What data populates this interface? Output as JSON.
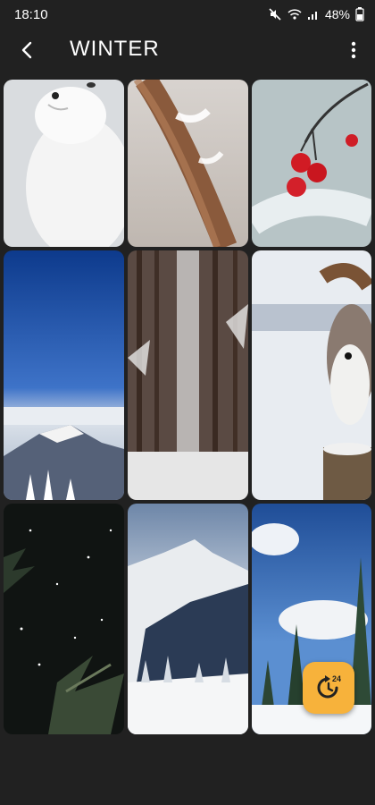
{
  "status_bar": {
    "time": "18:10",
    "battery": "48%",
    "icons": [
      "mute-icon",
      "wifi-icon",
      "signal-icon",
      "battery-icon"
    ]
  },
  "app_bar": {
    "title": "WINTER",
    "back_icon": "back-arrow-icon",
    "menu_icon": "more-vert-icon"
  },
  "wallpapers": [
    {
      "subject": "arctic-fox"
    },
    {
      "subject": "snowy-reed"
    },
    {
      "subject": "red-berries"
    },
    {
      "subject": "snowy-mountain-sky"
    },
    {
      "subject": "snowy-forest-path"
    },
    {
      "subject": "squirrel"
    },
    {
      "subject": "night-pine-snow"
    },
    {
      "subject": "alpine-valley"
    },
    {
      "subject": "snowy-fir-trees"
    }
  ],
  "fab": {
    "icon": "auto-rotate-24-icon",
    "badge": "24",
    "color": "#F7B23B"
  }
}
